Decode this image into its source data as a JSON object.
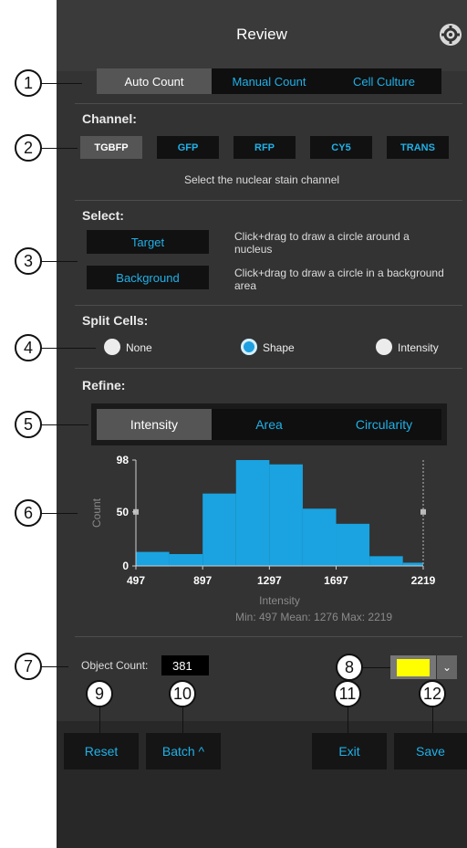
{
  "header": {
    "title": "Review"
  },
  "mode_tabs": [
    "Auto Count",
    "Manual Count",
    "Cell Culture"
  ],
  "channel": {
    "title": "Channel:",
    "options": [
      "TGBFP",
      "GFP",
      "RFP",
      "CY5",
      "TRANS"
    ],
    "selected": "TGBFP",
    "hint": "Select the nuclear stain channel"
  },
  "select": {
    "title": "Select:",
    "target_label": "Target",
    "target_hint": "Click+drag to draw a circle around a nucleus",
    "background_label": "Background",
    "background_hint": "Click+drag to draw a circle in a background area"
  },
  "split": {
    "title": "Split Cells:",
    "options": [
      "None",
      "Shape",
      "Intensity"
    ],
    "selected": "Shape"
  },
  "refine": {
    "title": "Refine:",
    "tabs": [
      "Intensity",
      "Area",
      "Circularity"
    ],
    "selected": "Intensity"
  },
  "chart_data": {
    "type": "bar",
    "bins": [
      [
        497,
        697
      ],
      [
        697,
        897
      ],
      [
        897,
        1097
      ],
      [
        1097,
        1297
      ],
      [
        1297,
        1497
      ],
      [
        1497,
        1697
      ],
      [
        1697,
        1897
      ],
      [
        1897,
        2097
      ],
      [
        2097,
        2219
      ]
    ],
    "values": [
      13,
      11,
      67,
      98,
      94,
      53,
      39,
      9,
      3
    ],
    "xlabel": "Intensity",
    "ylabel": "Count",
    "xticks": [
      "497",
      "897",
      "1297",
      "1697",
      "2219"
    ],
    "yticks": [
      "0",
      "50",
      "98"
    ],
    "xlim": [
      497,
      2219
    ],
    "ylim": [
      0,
      98
    ],
    "stats": "Min: 497  Mean: 1276  Max: 2219",
    "color": "#1aa3e0"
  },
  "object_count": {
    "label": "Object Count:",
    "value": "381"
  },
  "color": {
    "swatch": "#ffff00"
  },
  "buttons": {
    "reset": "Reset",
    "batch": "Batch ^",
    "exit": "Exit",
    "save": "Save"
  },
  "callouts": [
    "1",
    "2",
    "3",
    "4",
    "5",
    "6",
    "7",
    "8",
    "9",
    "10",
    "11",
    "12"
  ],
  "icons": {
    "gear": "gear-icon",
    "dropdown": "chevron-down-icon"
  }
}
